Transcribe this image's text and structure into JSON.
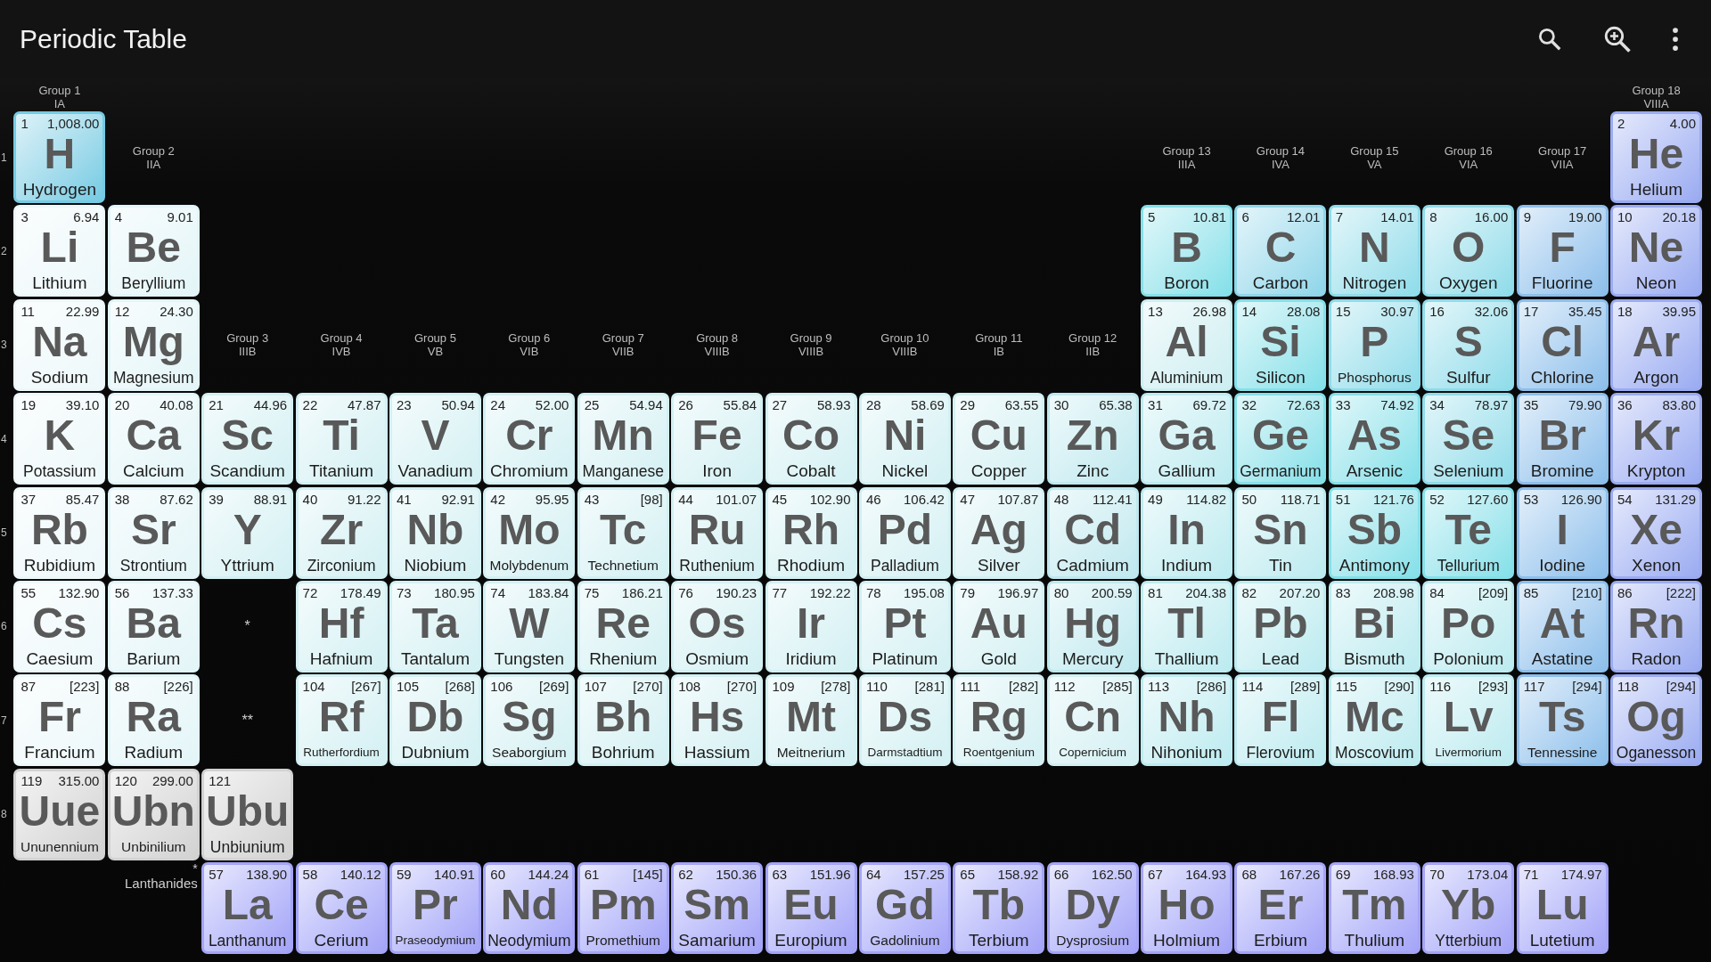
{
  "app_bar": {
    "title": "Periodic Table"
  },
  "header_cells": [
    {
      "name": "Group 1",
      "roman": "IA"
    },
    null,
    null,
    null,
    null,
    null,
    null,
    null,
    null,
    null,
    null,
    null,
    null,
    null,
    null,
    null,
    null,
    {
      "name": "Group 18",
      "roman": "VIIIA"
    }
  ],
  "periods": [
    {
      "label": "1",
      "cells": [
        {
          "kind": "element",
          "number": "1",
          "mass": "1,008.00",
          "symbol": "H",
          "name": "Hydrogen",
          "color": "#75cbe3"
        },
        {
          "kind": "group",
          "name": "Group 2",
          "roman": "IIA"
        },
        null,
        null,
        null,
        null,
        null,
        null,
        null,
        null,
        null,
        null,
        {
          "kind": "group",
          "name": "Group 13",
          "roman": "IIIA"
        },
        {
          "kind": "group",
          "name": "Group 14",
          "roman": "IVA"
        },
        {
          "kind": "group",
          "name": "Group 15",
          "roman": "VA"
        },
        {
          "kind": "group",
          "name": "Group 16",
          "roman": "VIA"
        },
        {
          "kind": "group",
          "name": "Group 17",
          "roman": "VIIA"
        },
        {
          "kind": "element",
          "number": "2",
          "mass": "4.00",
          "symbol": "He",
          "name": "Helium",
          "color": "#9babf1"
        }
      ]
    },
    {
      "label": "2",
      "cells": [
        {
          "kind": "element",
          "number": "3",
          "mass": "6.94",
          "symbol": "Li",
          "name": "Lithium",
          "color": "#edf8fa"
        },
        {
          "kind": "element",
          "number": "4",
          "mass": "9.01",
          "symbol": "Be",
          "name": "Beryllium",
          "color": "#e3f5f8"
        },
        null,
        null,
        null,
        null,
        null,
        null,
        null,
        null,
        null,
        null,
        {
          "kind": "element",
          "number": "5",
          "mass": "10.81",
          "symbol": "B",
          "name": "Boron",
          "color": "#84e0e9"
        },
        {
          "kind": "element",
          "number": "6",
          "mass": "12.01",
          "symbol": "C",
          "name": "Carbon",
          "color": "#8fd6ea"
        },
        {
          "kind": "element",
          "number": "7",
          "mass": "14.01",
          "symbol": "N",
          "name": "Nitrogen",
          "color": "#8fdcea"
        },
        {
          "kind": "element",
          "number": "8",
          "mass": "16.00",
          "symbol": "O",
          "name": "Oxygen",
          "color": "#8fdcea"
        },
        {
          "kind": "element",
          "number": "9",
          "mass": "19.00",
          "symbol": "F",
          "name": "Fluorine",
          "color": "#8dbfeb"
        },
        {
          "kind": "element",
          "number": "10",
          "mass": "20.18",
          "symbol": "Ne",
          "name": "Neon",
          "color": "#9babf1"
        }
      ]
    },
    {
      "label": "3",
      "cells": [
        {
          "kind": "element",
          "number": "11",
          "mass": "22.99",
          "symbol": "Na",
          "name": "Sodium",
          "color": "#edf8fa"
        },
        {
          "kind": "element",
          "number": "12",
          "mass": "24.30",
          "symbol": "Mg",
          "name": "Magnesium",
          "color": "#e3f5f8"
        },
        {
          "kind": "group",
          "name": "Group 3",
          "roman": "IIIB"
        },
        {
          "kind": "group",
          "name": "Group 4",
          "roman": "IVB"
        },
        {
          "kind": "group",
          "name": "Group 5",
          "roman": "VB"
        },
        {
          "kind": "group",
          "name": "Group 6",
          "roman": "VIB"
        },
        {
          "kind": "group",
          "name": "Group 7",
          "roman": "VIIB"
        },
        {
          "kind": "group",
          "name": "Group 8",
          "roman": "VIIIB"
        },
        {
          "kind": "group",
          "name": "Group 9",
          "roman": "VIIIB"
        },
        {
          "kind": "group",
          "name": "Group 10",
          "roman": "VIIIB"
        },
        {
          "kind": "group",
          "name": "Group 11",
          "roman": "IB"
        },
        {
          "kind": "group",
          "name": "Group 12",
          "roman": "IIB"
        },
        {
          "kind": "element",
          "number": "13",
          "mass": "26.98",
          "symbol": "Al",
          "name": "Aluminium",
          "color": "#cdeef1"
        },
        {
          "kind": "element",
          "number": "14",
          "mass": "28.08",
          "symbol": "Si",
          "name": "Silicon",
          "color": "#84e0e9"
        },
        {
          "kind": "element",
          "number": "15",
          "mass": "30.97",
          "symbol": "P",
          "name": "Phosphorus",
          "color": "#8fdcea"
        },
        {
          "kind": "element",
          "number": "16",
          "mass": "32.06",
          "symbol": "S",
          "name": "Sulfur",
          "color": "#8fdcea"
        },
        {
          "kind": "element",
          "number": "17",
          "mass": "35.45",
          "symbol": "Cl",
          "name": "Chlorine",
          "color": "#8dbfeb"
        },
        {
          "kind": "element",
          "number": "18",
          "mass": "39.95",
          "symbol": "Ar",
          "name": "Argon",
          "color": "#9babf1"
        }
      ]
    },
    {
      "label": "4",
      "cells": [
        {
          "kind": "element",
          "number": "19",
          "mass": "39.10",
          "symbol": "K",
          "name": "Potassium",
          "color": "#edf8fa"
        },
        {
          "kind": "element",
          "number": "20",
          "mass": "40.08",
          "symbol": "Ca",
          "name": "Calcium",
          "color": "#e3f5f8"
        },
        {
          "kind": "element",
          "number": "21",
          "mass": "44.96",
          "symbol": "Sc",
          "name": "Scandium",
          "color": "#d3f0f3"
        },
        {
          "kind": "element",
          "number": "22",
          "mass": "47.87",
          "symbol": "Ti",
          "name": "Titanium",
          "color": "#d3f0f3"
        },
        {
          "kind": "element",
          "number": "23",
          "mass": "50.94",
          "symbol": "V",
          "name": "Vanadium",
          "color": "#d3f0f3"
        },
        {
          "kind": "element",
          "number": "24",
          "mass": "52.00",
          "symbol": "Cr",
          "name": "Chromium",
          "color": "#d3f0f3"
        },
        {
          "kind": "element",
          "number": "25",
          "mass": "54.94",
          "symbol": "Mn",
          "name": "Manganese",
          "color": "#d3f0f3"
        },
        {
          "kind": "element",
          "number": "26",
          "mass": "55.84",
          "symbol": "Fe",
          "name": "Iron",
          "color": "#d3f0f3"
        },
        {
          "kind": "element",
          "number": "27",
          "mass": "58.93",
          "symbol": "Co",
          "name": "Cobalt",
          "color": "#d3f0f3"
        },
        {
          "kind": "element",
          "number": "28",
          "mass": "58.69",
          "symbol": "Ni",
          "name": "Nickel",
          "color": "#d3f0f3"
        },
        {
          "kind": "element",
          "number": "29",
          "mass": "63.55",
          "symbol": "Cu",
          "name": "Copper",
          "color": "#d3f0f3"
        },
        {
          "kind": "element",
          "number": "30",
          "mass": "65.38",
          "symbol": "Zn",
          "name": "Zinc",
          "color": "#bfe9ef"
        },
        {
          "kind": "element",
          "number": "31",
          "mass": "69.72",
          "symbol": "Ga",
          "name": "Gallium",
          "color": "#bcebf0"
        },
        {
          "kind": "element",
          "number": "32",
          "mass": "72.63",
          "symbol": "Ge",
          "name": "Germanium",
          "color": "#84e0e9"
        },
        {
          "kind": "element",
          "number": "33",
          "mass": "74.92",
          "symbol": "As",
          "name": "Arsenic",
          "color": "#84e0e9"
        },
        {
          "kind": "element",
          "number": "34",
          "mass": "78.97",
          "symbol": "Se",
          "name": "Selenium",
          "color": "#8fdcea"
        },
        {
          "kind": "element",
          "number": "35",
          "mass": "79.90",
          "symbol": "Br",
          "name": "Bromine",
          "color": "#8dbfeb"
        },
        {
          "kind": "element",
          "number": "36",
          "mass": "83.80",
          "symbol": "Kr",
          "name": "Krypton",
          "color": "#9babf1"
        }
      ]
    },
    {
      "label": "5",
      "cells": [
        {
          "kind": "element",
          "number": "37",
          "mass": "85.47",
          "symbol": "Rb",
          "name": "Rubidium",
          "color": "#edf8fa"
        },
        {
          "kind": "element",
          "number": "38",
          "mass": "87.62",
          "symbol": "Sr",
          "name": "Strontium",
          "color": "#e3f5f8"
        },
        {
          "kind": "element",
          "number": "39",
          "mass": "88.91",
          "symbol": "Y",
          "name": "Yttrium",
          "color": "#d3f0f3"
        },
        {
          "kind": "element",
          "number": "40",
          "mass": "91.22",
          "symbol": "Zr",
          "name": "Zirconium",
          "color": "#d3f0f3"
        },
        {
          "kind": "element",
          "number": "41",
          "mass": "92.91",
          "symbol": "Nb",
          "name": "Niobium",
          "color": "#d3f0f3"
        },
        {
          "kind": "element",
          "number": "42",
          "mass": "95.95",
          "symbol": "Mo",
          "name": "Molybdenum",
          "color": "#d3f0f3"
        },
        {
          "kind": "element",
          "number": "43",
          "mass": "[98]",
          "symbol": "Tc",
          "name": "Technetium",
          "color": "#d3f0f3"
        },
        {
          "kind": "element",
          "number": "44",
          "mass": "101.07",
          "symbol": "Ru",
          "name": "Ruthenium",
          "color": "#d3f0f3"
        },
        {
          "kind": "element",
          "number": "45",
          "mass": "102.90",
          "symbol": "Rh",
          "name": "Rhodium",
          "color": "#d3f0f3"
        },
        {
          "kind": "element",
          "number": "46",
          "mass": "106.42",
          "symbol": "Pd",
          "name": "Palladium",
          "color": "#d3f0f3"
        },
        {
          "kind": "element",
          "number": "47",
          "mass": "107.87",
          "symbol": "Ag",
          "name": "Silver",
          "color": "#d3f0f3"
        },
        {
          "kind": "element",
          "number": "48",
          "mass": "112.41",
          "symbol": "Cd",
          "name": "Cadmium",
          "color": "#bfe9ef"
        },
        {
          "kind": "element",
          "number": "49",
          "mass": "114.82",
          "symbol": "In",
          "name": "Indium",
          "color": "#bcebf0"
        },
        {
          "kind": "element",
          "number": "50",
          "mass": "118.71",
          "symbol": "Sn",
          "name": "Tin",
          "color": "#bcebf0"
        },
        {
          "kind": "element",
          "number": "51",
          "mass": "121.76",
          "symbol": "Sb",
          "name": "Antimony",
          "color": "#84e0e9"
        },
        {
          "kind": "element",
          "number": "52",
          "mass": "127.60",
          "symbol": "Te",
          "name": "Tellurium",
          "color": "#84e0e9"
        },
        {
          "kind": "element",
          "number": "53",
          "mass": "126.90",
          "symbol": "I",
          "name": "Iodine",
          "color": "#8dbfeb"
        },
        {
          "kind": "element",
          "number": "54",
          "mass": "131.29",
          "symbol": "Xe",
          "name": "Xenon",
          "color": "#9babf1"
        }
      ]
    },
    {
      "label": "6",
      "cells": [
        {
          "kind": "element",
          "number": "55",
          "mass": "132.90",
          "symbol": "Cs",
          "name": "Caesium",
          "color": "#edf8fa"
        },
        {
          "kind": "element",
          "number": "56",
          "mass": "137.33",
          "symbol": "Ba",
          "name": "Barium",
          "color": "#e3f5f8"
        },
        {
          "kind": "marker",
          "text": "*"
        },
        {
          "kind": "element",
          "number": "72",
          "mass": "178.49",
          "symbol": "Hf",
          "name": "Hafnium",
          "color": "#d3f0f3"
        },
        {
          "kind": "element",
          "number": "73",
          "mass": "180.95",
          "symbol": "Ta",
          "name": "Tantalum",
          "color": "#d3f0f3"
        },
        {
          "kind": "element",
          "number": "74",
          "mass": "183.84",
          "symbol": "W",
          "name": "Tungsten",
          "color": "#d3f0f3"
        },
        {
          "kind": "element",
          "number": "75",
          "mass": "186.21",
          "symbol": "Re",
          "name": "Rhenium",
          "color": "#d3f0f3"
        },
        {
          "kind": "element",
          "number": "76",
          "mass": "190.23",
          "symbol": "Os",
          "name": "Osmium",
          "color": "#d3f0f3"
        },
        {
          "kind": "element",
          "number": "77",
          "mass": "192.22",
          "symbol": "Ir",
          "name": "Iridium",
          "color": "#d3f0f3"
        },
        {
          "kind": "element",
          "number": "78",
          "mass": "195.08",
          "symbol": "Pt",
          "name": "Platinum",
          "color": "#d3f0f3"
        },
        {
          "kind": "element",
          "number": "79",
          "mass": "196.97",
          "symbol": "Au",
          "name": "Gold",
          "color": "#d3f0f3"
        },
        {
          "kind": "element",
          "number": "80",
          "mass": "200.59",
          "symbol": "Hg",
          "name": "Mercury",
          "color": "#bfe9ef"
        },
        {
          "kind": "element",
          "number": "81",
          "mass": "204.38",
          "symbol": "Tl",
          "name": "Thallium",
          "color": "#bcebf0"
        },
        {
          "kind": "element",
          "number": "82",
          "mass": "207.20",
          "symbol": "Pb",
          "name": "Lead",
          "color": "#bcebf0"
        },
        {
          "kind": "element",
          "number": "83",
          "mass": "208.98",
          "symbol": "Bi",
          "name": "Bismuth",
          "color": "#bcebf0"
        },
        {
          "kind": "element",
          "number": "84",
          "mass": "[209]",
          "symbol": "Po",
          "name": "Polonium",
          "color": "#bcebf0"
        },
        {
          "kind": "element",
          "number": "85",
          "mass": "[210]",
          "symbol": "At",
          "name": "Astatine",
          "color": "#8dbfeb"
        },
        {
          "kind": "element",
          "number": "86",
          "mass": "[222]",
          "symbol": "Rn",
          "name": "Radon",
          "color": "#9babf1"
        }
      ]
    },
    {
      "label": "7",
      "cells": [
        {
          "kind": "element",
          "number": "87",
          "mass": "[223]",
          "symbol": "Fr",
          "name": "Francium",
          "color": "#edf8fa"
        },
        {
          "kind": "element",
          "number": "88",
          "mass": "[226]",
          "symbol": "Ra",
          "name": "Radium",
          "color": "#e3f5f8"
        },
        {
          "kind": "marker",
          "text": "**"
        },
        {
          "kind": "element",
          "number": "104",
          "mass": "[267]",
          "symbol": "Rf",
          "name": "Rutherfordium",
          "color": "#d3f0f3"
        },
        {
          "kind": "element",
          "number": "105",
          "mass": "[268]",
          "symbol": "Db",
          "name": "Dubnium",
          "color": "#d3f0f3"
        },
        {
          "kind": "element",
          "number": "106",
          "mass": "[269]",
          "symbol": "Sg",
          "name": "Seaborgium",
          "color": "#d3f0f3"
        },
        {
          "kind": "element",
          "number": "107",
          "mass": "[270]",
          "symbol": "Bh",
          "name": "Bohrium",
          "color": "#d3f0f3"
        },
        {
          "kind": "element",
          "number": "108",
          "mass": "[270]",
          "symbol": "Hs",
          "name": "Hassium",
          "color": "#d3f0f3"
        },
        {
          "kind": "element",
          "number": "109",
          "mass": "[278]",
          "symbol": "Mt",
          "name": "Meitnerium",
          "color": "#d3f0f3"
        },
        {
          "kind": "element",
          "number": "110",
          "mass": "[281]",
          "symbol": "Ds",
          "name": "Darmstadtium",
          "color": "#d3f0f3"
        },
        {
          "kind": "element",
          "number": "111",
          "mass": "[282]",
          "symbol": "Rg",
          "name": "Roentgenium",
          "color": "#d3f0f3"
        },
        {
          "kind": "element",
          "number": "112",
          "mass": "[285]",
          "symbol": "Cn",
          "name": "Copernicium",
          "color": "#d3f0f3"
        },
        {
          "kind": "element",
          "number": "113",
          "mass": "[286]",
          "symbol": "Nh",
          "name": "Nihonium",
          "color": "#bcebf0"
        },
        {
          "kind": "element",
          "number": "114",
          "mass": "[289]",
          "symbol": "Fl",
          "name": "Flerovium",
          "color": "#bcebf0"
        },
        {
          "kind": "element",
          "number": "115",
          "mass": "[290]",
          "symbol": "Mc",
          "name": "Moscovium",
          "color": "#bcebf0"
        },
        {
          "kind": "element",
          "number": "116",
          "mass": "[293]",
          "symbol": "Lv",
          "name": "Livermorium",
          "color": "#bcebf0"
        },
        {
          "kind": "element",
          "number": "117",
          "mass": "[294]",
          "symbol": "Ts",
          "name": "Tennessine",
          "color": "#8dbfeb"
        },
        {
          "kind": "element",
          "number": "118",
          "mass": "[294]",
          "symbol": "Og",
          "name": "Oganesson",
          "color": "#9babf1"
        }
      ]
    },
    {
      "label": "8",
      "cells": [
        {
          "kind": "element",
          "number": "119",
          "mass": "315.00",
          "symbol": "Uue",
          "name": "Ununennium",
          "color": "#d2d2d2"
        },
        {
          "kind": "element",
          "number": "120",
          "mass": "299.00",
          "symbol": "Ubn",
          "name": "Unbinilium",
          "color": "#d2d2d2"
        },
        {
          "kind": "element",
          "number": "121",
          "symbol": "Ubu",
          "name": "Unbiunium",
          "color": "#d2d2d2"
        }
      ]
    }
  ],
  "lanthanides": {
    "marker": "*",
    "label": "Lanthanides",
    "elements": [
      {
        "number": "57",
        "mass": "138.90",
        "symbol": "La",
        "name": "Lanthanum",
        "color": "#a4a4f7"
      },
      {
        "number": "58",
        "mass": "140.12",
        "symbol": "Ce",
        "name": "Cerium",
        "color": "#a4a4f7"
      },
      {
        "number": "59",
        "mass": "140.91",
        "symbol": "Pr",
        "name": "Praseodymium",
        "color": "#a4a4f7"
      },
      {
        "number": "60",
        "mass": "144.24",
        "symbol": "Nd",
        "name": "Neodymium",
        "color": "#a4a4f7"
      },
      {
        "number": "61",
        "mass": "[145]",
        "symbol": "Pm",
        "name": "Promethium",
        "color": "#a4a4f7"
      },
      {
        "number": "62",
        "mass": "150.36",
        "symbol": "Sm",
        "name": "Samarium",
        "color": "#a4a4f7"
      },
      {
        "number": "63",
        "mass": "151.96",
        "symbol": "Eu",
        "name": "Europium",
        "color": "#a4a4f7"
      },
      {
        "number": "64",
        "mass": "157.25",
        "symbol": "Gd",
        "name": "Gadolinium",
        "color": "#a4a4f7"
      },
      {
        "number": "65",
        "mass": "158.92",
        "symbol": "Tb",
        "name": "Terbium",
        "color": "#a4a4f7"
      },
      {
        "number": "66",
        "mass": "162.50",
        "symbol": "Dy",
        "name": "Dysprosium",
        "color": "#a4a4f7"
      },
      {
        "number": "67",
        "mass": "164.93",
        "symbol": "Ho",
        "name": "Holmium",
        "color": "#a4a4f7"
      },
      {
        "number": "68",
        "mass": "167.26",
        "symbol": "Er",
        "name": "Erbium",
        "color": "#a4a4f7"
      },
      {
        "number": "69",
        "mass": "168.93",
        "symbol": "Tm",
        "name": "Thulium",
        "color": "#a4a4f7"
      },
      {
        "number": "70",
        "mass": "173.04",
        "symbol": "Yb",
        "name": "Ytterbium",
        "color": "#a4a4f7"
      },
      {
        "number": "71",
        "mass": "174.97",
        "symbol": "Lu",
        "name": "Lutetium",
        "color": "#a4a4f7"
      }
    ]
  }
}
